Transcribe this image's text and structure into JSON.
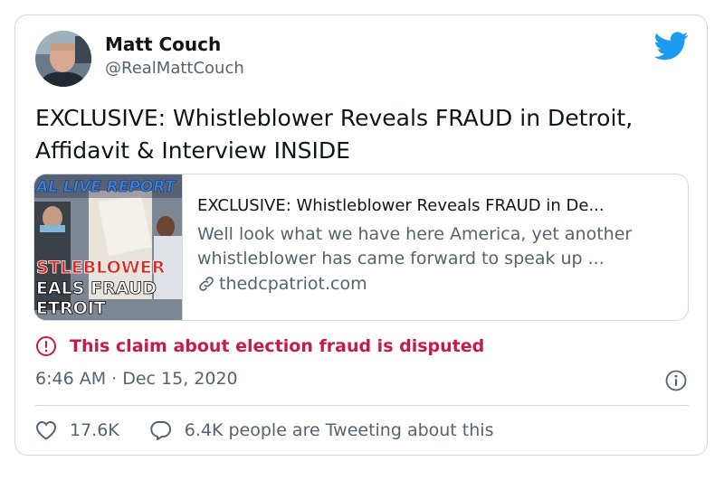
{
  "author": {
    "display_name": "Matt Couch",
    "handle": "@RealMattCouch",
    "avatar_icon": "avatar-photo"
  },
  "brand": {
    "icon": "twitter-bird-icon",
    "color": "#1d9bf0"
  },
  "tweet": {
    "text": "EXCLUSIVE: Whistleblower Reveals FRAUD in Detroit, Affidavit & Interview INSIDE"
  },
  "link_card": {
    "thumbnail": {
      "banner": "AL LIVE REPORT",
      "line1": "STLEBLOWER",
      "line2": "EALS FRAUD",
      "line3": "ETROIT"
    },
    "title": "EXCLUSIVE: Whistleblower Reveals FRAUD in De...",
    "description": "Well look what we have here America, yet another whistleblower has came forward to speak up ...",
    "domain": "thedcpatriot.com",
    "domain_icon": "link-icon"
  },
  "disputed": {
    "text": "This claim about election fraud is disputed",
    "icon": "alert-circle-icon",
    "color": "#c9184a"
  },
  "timestamp": "6:46 AM · Dec 15, 2020",
  "info_icon": "info-icon",
  "actions": {
    "likes": {
      "count": "17.6K",
      "icon": "heart-icon"
    },
    "replies": {
      "label": "6.4K people are Tweeting about this",
      "icon": "speech-bubble-icon"
    }
  },
  "colors": {
    "text_primary": "#0f1419",
    "text_secondary": "#536471",
    "border": "#cfd9de"
  }
}
